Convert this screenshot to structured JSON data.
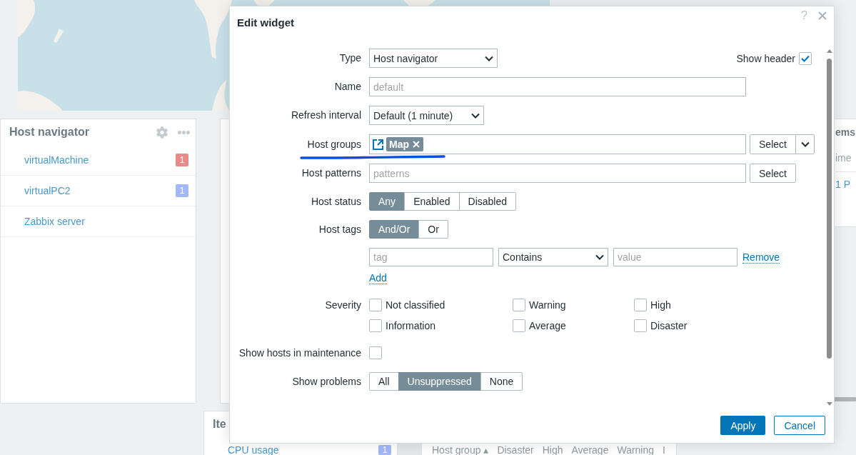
{
  "host_navigator": {
    "title": "Host navigator",
    "hosts": [
      {
        "name": "virtualMachine",
        "problems": "1",
        "color": "#e88a8a"
      },
      {
        "name": "virtualPC2",
        "problems": "1",
        "color": "#a3b8f8"
      },
      {
        "name": "Zabbix server"
      }
    ]
  },
  "right_widget": {
    "title": "ems",
    "column_1": "ime",
    "cell": "1 P"
  },
  "bottom_left_widget": {
    "title": "Ite",
    "rows": [
      {
        "name": "CPU usage",
        "problems": "1",
        "color": "#a3b8f8"
      }
    ]
  },
  "table_widget": {
    "columns": [
      "Host group ▴",
      "Disaster",
      "High",
      "Average",
      "Warning",
      "I"
    ]
  },
  "dialog": {
    "title": "Edit widget",
    "help": "?",
    "fields": [
      {
        "kind": "select",
        "label": "Type",
        "value": "Host navigator",
        "show_header": {
          "label": "Show header",
          "checked": true
        }
      },
      {
        "kind": "text",
        "label": "Name",
        "placeholder": "default"
      },
      {
        "kind": "select",
        "label": "Refresh interval",
        "value": "Default (1 minute)"
      },
      {
        "kind": "multiselect",
        "label": "Host groups",
        "chips": [
          "Map"
        ],
        "button": "Select"
      },
      {
        "kind": "text",
        "label": "Host patterns",
        "placeholder": "patterns",
        "button": "Select"
      },
      {
        "kind": "segmented",
        "label": "Host status",
        "options": [
          {
            "label": "Any",
            "selected": true
          },
          {
            "label": "Enabled",
            "selected": false
          },
          {
            "label": "Disabled",
            "selected": false
          }
        ]
      },
      {
        "kind": "segmented",
        "label": "Host tags",
        "options": [
          {
            "label": "And/Or",
            "selected": true
          },
          {
            "label": "Or",
            "selected": false
          }
        ]
      },
      {
        "kind": "tags",
        "tags": [
          {
            "tag_placeholder": "tag",
            "operator": "Contains",
            "value_placeholder": "value",
            "remove": "Remove"
          }
        ],
        "add": "Add"
      },
      {
        "kind": "checkgrid",
        "label": "Severity",
        "options": [
          {
            "label": "Not classified",
            "checked": false
          },
          {
            "label": "Warning",
            "checked": false
          },
          {
            "label": "High",
            "checked": false
          },
          {
            "label": "Information",
            "checked": false
          },
          {
            "label": "Average",
            "checked": false
          },
          {
            "label": "Disaster",
            "checked": false
          }
        ]
      },
      {
        "kind": "checkbox",
        "label": "Show hosts in maintenance",
        "checked": false
      },
      {
        "kind": "segmented",
        "label": "Show problems",
        "options": [
          {
            "label": "All",
            "selected": false
          },
          {
            "label": "Unsuppressed",
            "selected": true
          },
          {
            "label": "None",
            "selected": false
          }
        ]
      }
    ],
    "buttons": [
      {
        "label": "Apply",
        "kind": "primary"
      },
      {
        "label": "Cancel",
        "kind": "secondary"
      }
    ]
  }
}
